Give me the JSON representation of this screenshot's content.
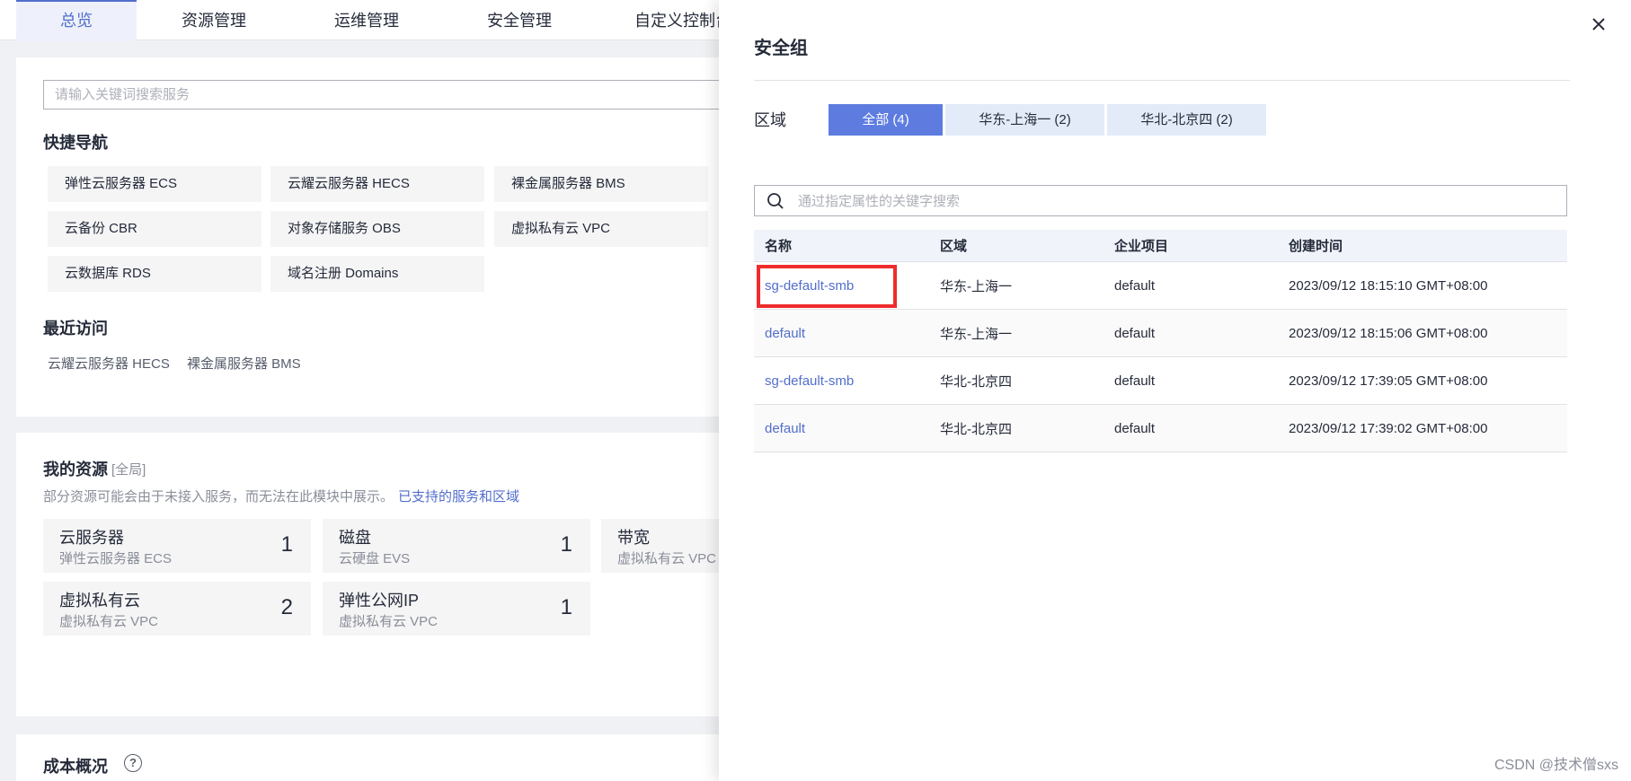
{
  "nav": {
    "tabs": [
      "总览",
      "资源管理",
      "运维管理",
      "安全管理",
      "自定义控制台"
    ]
  },
  "search": {
    "placeholder": "请输入关键词搜索服务"
  },
  "quick_nav": {
    "title": "快捷导航",
    "items": [
      "弹性云服务器 ECS",
      "云耀云服务器 HECS",
      "裸金属服务器 BMS",
      "云备份 CBR",
      "对象存储服务 OBS",
      "虚拟私有云 VPC",
      "云数据库 RDS",
      "域名注册 Domains"
    ]
  },
  "recent": {
    "title": "最近访问",
    "items": [
      "云耀云服务器 HECS",
      "裸金属服务器 BMS"
    ]
  },
  "my_resources": {
    "title": "我的资源",
    "scope": "[全局]",
    "note": "部分资源可能会由于未接入服务，而无法在此模块中展示。",
    "supported_link": "已支持的服务和区域",
    "cards": [
      {
        "title": "云服务器",
        "sub": "弹性云服务器 ECS",
        "count": "1"
      },
      {
        "title": "磁盘",
        "sub": "云硬盘 EVS",
        "count": "1"
      },
      {
        "title": "带宽",
        "sub": "虚拟私有云 VPC",
        "count": ""
      },
      {
        "title": "虚拟私有云",
        "sub": "虚拟私有云 VPC",
        "count": "2"
      },
      {
        "title": "弹性公网IP",
        "sub": "虚拟私有云 VPC",
        "count": "1"
      }
    ]
  },
  "cost": {
    "title": "成本概况"
  },
  "drawer": {
    "title": "安全组",
    "region_label": "区域",
    "region_tabs": [
      "全部 (4)",
      "华东-上海一 (2)",
      "华北-北京四 (2)"
    ],
    "search_placeholder": "通过指定属性的关键字搜索",
    "columns": [
      "名称",
      "区域",
      "企业项目",
      "创建时间"
    ],
    "rows": [
      {
        "name": "sg-default-smb",
        "region": "华东-上海一",
        "project": "default",
        "created": "2023/09/12 18:15:10 GMT+08:00"
      },
      {
        "name": "default",
        "region": "华东-上海一",
        "project": "default",
        "created": "2023/09/12 18:15:06 GMT+08:00"
      },
      {
        "name": "sg-default-smb",
        "region": "华北-北京四",
        "project": "default",
        "created": "2023/09/12 17:39:05 GMT+08:00"
      },
      {
        "name": "default",
        "region": "华北-北京四",
        "project": "default",
        "created": "2023/09/12 17:39:02 GMT+08:00"
      }
    ]
  },
  "watermark": "CSDN @技术僧sxs",
  "colors": {
    "accent": "#526ecc",
    "active_tab": "#5e7ce0",
    "highlight": "#ef2b2d"
  }
}
